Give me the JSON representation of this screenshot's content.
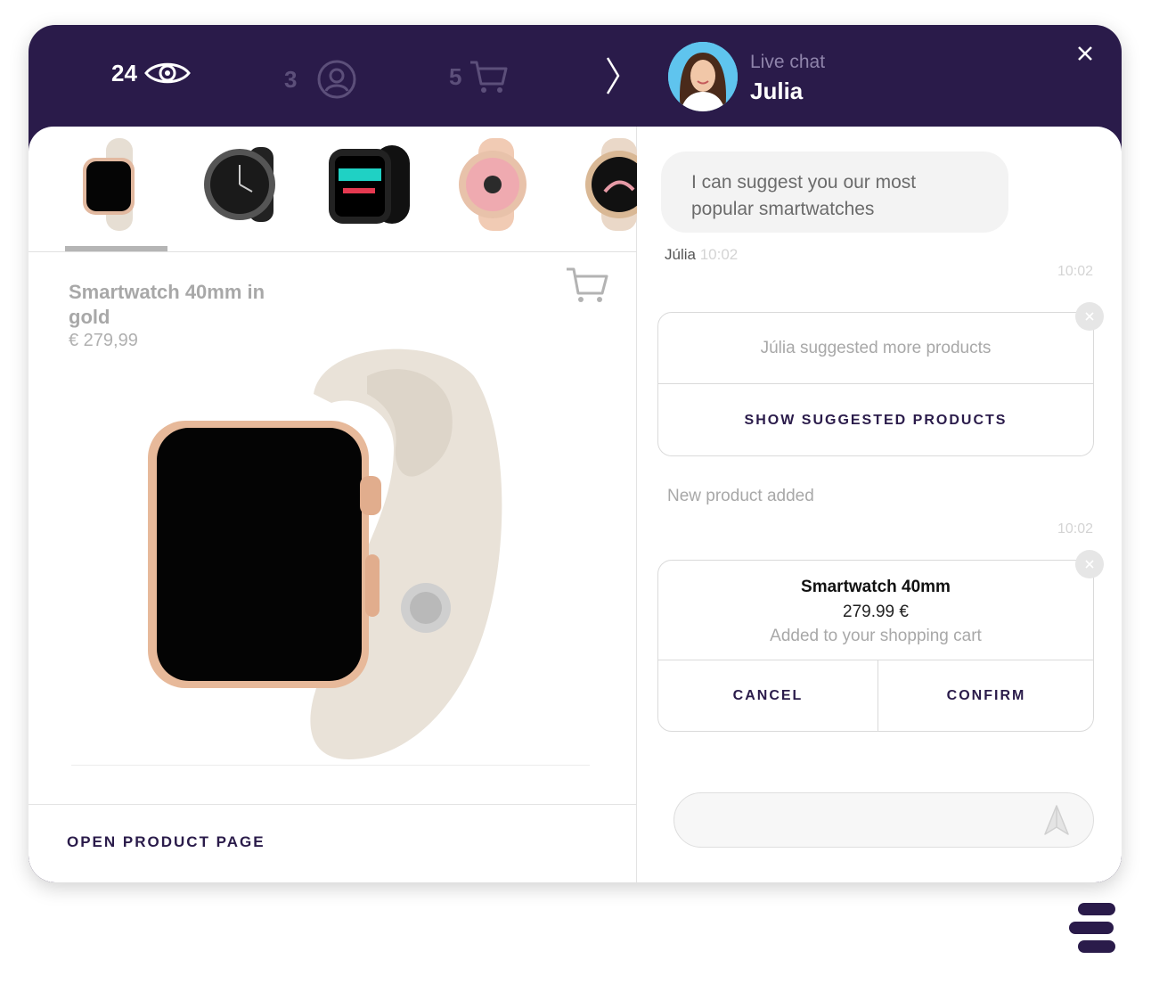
{
  "header": {
    "stats": [
      {
        "value": "24",
        "icon": "eye-icon"
      },
      {
        "value": "3",
        "icon": "user-circle-icon"
      },
      {
        "value": "5",
        "icon": "cart-icon"
      }
    ],
    "live_chat_label": "Live chat",
    "agent_name": "Julia"
  },
  "product": {
    "name": "Smartwatch 40mm in gold",
    "price": "€ 279,99",
    "open_page_label": "OPEN PRODUCT PAGE",
    "thumbnails": [
      "gold-starlight-watch",
      "black-round-watch",
      "black-digital-watch",
      "pink-round-watch",
      "gold-round-watch"
    ]
  },
  "chat": {
    "agent_message": "I can suggest you our most popular smartwatches",
    "agent_sender": "Júlia",
    "agent_time": "10:02",
    "timestamp_1": "10:02",
    "suggest_card": {
      "message": "Júlia suggested more products",
      "action": "SHOW SUGGESTED PRODUCTS"
    },
    "system_message": "New product added",
    "timestamp_2": "10:02",
    "cart_card": {
      "product_name": "Smartwatch 40mm",
      "price": "279.99 €",
      "note": "Added to your shopping cart",
      "cancel": "CANCEL",
      "confirm": "CONFIRM"
    },
    "input_placeholder": ""
  },
  "colors": {
    "brand_dark": "#2a1b4a",
    "muted_text": "#a8a8a8",
    "avatar_bg": "#5fc4ee"
  }
}
